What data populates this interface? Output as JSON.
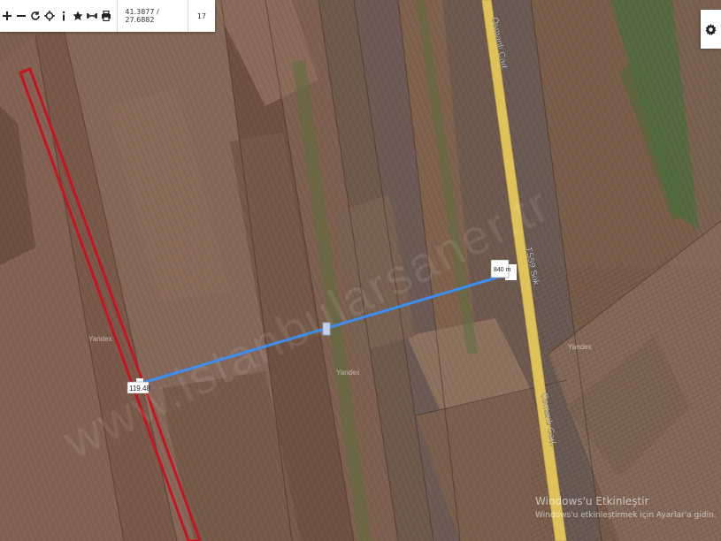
{
  "toolbar": {
    "buttons": [
      {
        "name": "zoom-in-button",
        "icon": "plus-icon"
      },
      {
        "name": "zoom-out-button",
        "icon": "minus-icon"
      },
      {
        "name": "refresh-button",
        "icon": "refresh-icon"
      },
      {
        "name": "locate-button",
        "icon": "crosshair-icon"
      },
      {
        "name": "info-button",
        "icon": "info-icon"
      },
      {
        "name": "favorite-button",
        "icon": "star-icon"
      },
      {
        "name": "measure-button",
        "icon": "ruler-icon"
      },
      {
        "name": "print-button",
        "icon": "print-icon"
      }
    ],
    "coordinates": "41.3877 / 27.6882",
    "zoom": "17"
  },
  "map": {
    "measure_total_label": "840 m",
    "measure_start_label": "119.48",
    "road_name_1": "Osmanlı Cad.",
    "road_name_2": "Osmanlı Cad.",
    "road_name_3": "TS59 Sok.",
    "provider_label_1": "Yandex",
    "provider_label_2": "Yandex",
    "provider_label_3": "Yandex",
    "watermark": "www.istanbularsaner.tr",
    "colors": {
      "measure_line": "#3d8ef2",
      "parcel_outline": "#c8141e",
      "road": "#e0c25a"
    }
  },
  "os_notice": {
    "title": "Windows'u Etkinleştir",
    "subtitle": "Windows'u etkinleştirmek için Ayarlar'a gidin."
  }
}
